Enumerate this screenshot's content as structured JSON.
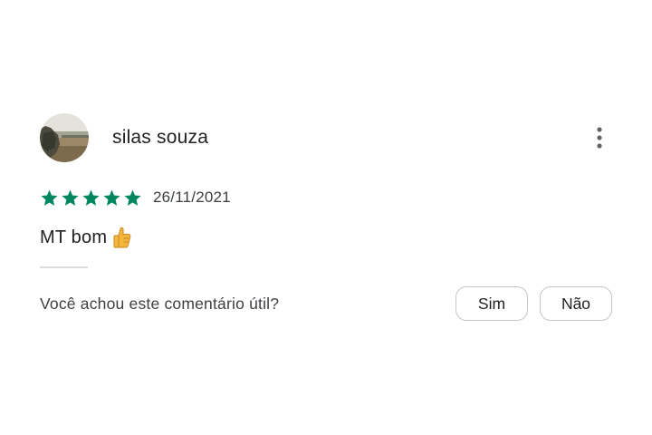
{
  "review": {
    "author": "silas souza",
    "rating": 5,
    "max_rating": 5,
    "date": "26/11/2021",
    "text": "MT bom",
    "emoji_icon": "thumbs-up-icon"
  },
  "helpful": {
    "question": "Você achou este comentário útil?",
    "yes_label": "Sim",
    "no_label": "Não"
  },
  "icons": {
    "menu": "more-vert-icon",
    "star": "star-icon"
  },
  "colors": {
    "star": "#01875f",
    "text": "#202124",
    "secondary_text": "#3c4043",
    "button_border": "#c4c7c5",
    "emoji": "#f4b63f"
  }
}
